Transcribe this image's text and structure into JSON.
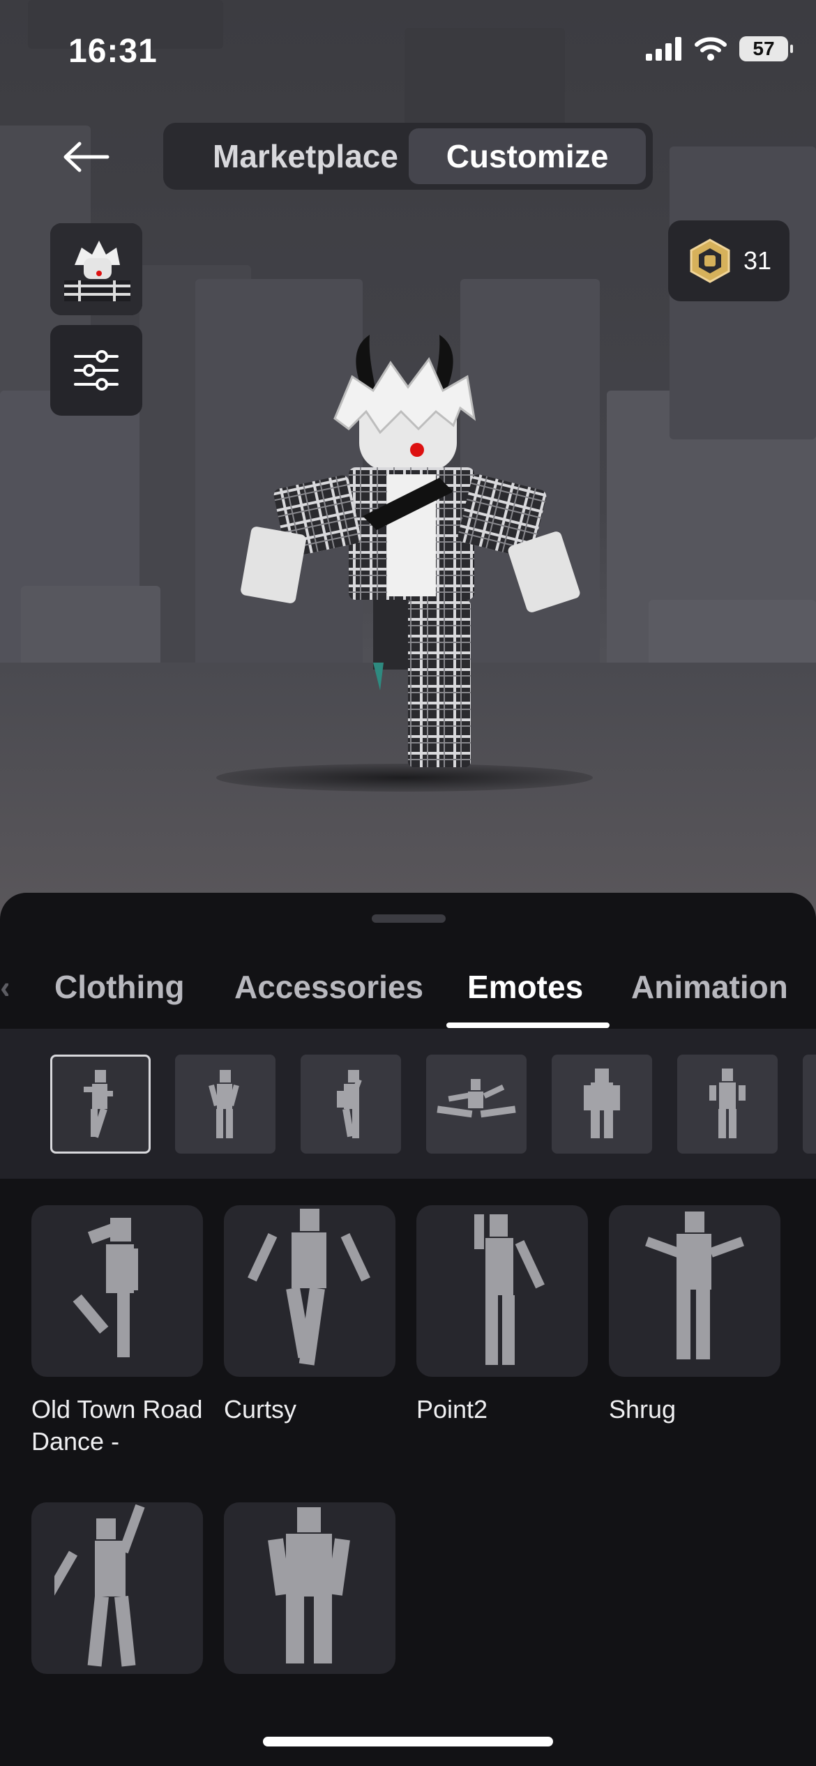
{
  "status_bar": {
    "time": "16:31",
    "battery": "57"
  },
  "nav": {
    "tab_marketplace": "Marketplace",
    "tab_customize": "Customize",
    "active": "Customize"
  },
  "robux": {
    "amount": "31"
  },
  "tabs": {
    "items": [
      "Clothing",
      "Accessories",
      "Emotes",
      "Animation"
    ],
    "active": "Emotes"
  },
  "emote_slots": [
    "slot-1",
    "slot-2",
    "slot-3",
    "slot-4",
    "slot-5",
    "slot-6"
  ],
  "emotes": [
    {
      "label": "Old Town Road Dance -"
    },
    {
      "label": "Curtsy"
    },
    {
      "label": "Point2"
    },
    {
      "label": "Shrug"
    },
    {
      "label": ""
    },
    {
      "label": ""
    }
  ],
  "colors": {
    "background": "#121215",
    "accent_underline": "#ffffff",
    "robux_gold": "#d6b15b"
  }
}
